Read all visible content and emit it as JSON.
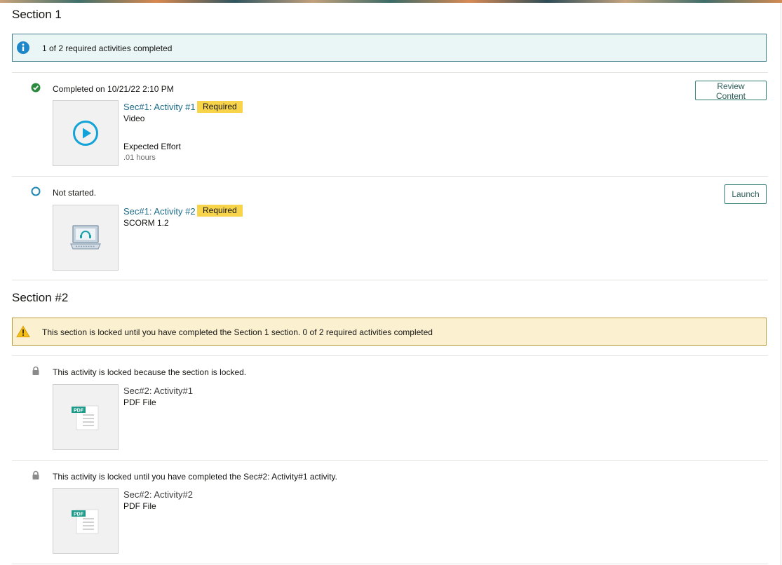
{
  "sections": [
    {
      "title": "Section 1",
      "banner": "1 of 2 required activities completed",
      "activities": [
        {
          "status": "Completed on 10/21/22 2:10 PM",
          "title": "Sec#1: Activity #1",
          "badge": "Required",
          "type": "Video",
          "effort_label": "Expected Effort",
          "effort_value": ".01 hours",
          "action": "Review Content"
        },
        {
          "status": "Not started.",
          "title": "Sec#1: Activity #2",
          "badge": "Required",
          "type": "SCORM 1.2",
          "action": "Launch"
        }
      ]
    },
    {
      "title": "Section #2",
      "banner": "This section is locked until you have completed the Section 1 section. 0 of 2 required activities completed",
      "activities": [
        {
          "status": "This activity is locked because the section is locked.",
          "title": "Sec#2: Activity#1",
          "type": "PDF File",
          "thumb_label": "PDF"
        },
        {
          "status": "This activity is locked until you have completed the Sec#2: Activity#1 activity.",
          "title": "Sec#2: Activity#2",
          "type": "PDF File",
          "thumb_label": "PDF"
        }
      ]
    }
  ],
  "colors": {
    "info_banner_bg": "#eaf6f6",
    "warn_banner_bg": "#fbf1d0",
    "required_badge": "#f8d44b",
    "link": "#1d6b8a",
    "completed_green": "#2b8a3e",
    "not_started_blue": "#1f87b5"
  },
  "icons": {
    "info": "info-icon",
    "warning": "warning-icon",
    "completed": "check-circle-icon",
    "not_started": "empty-circle-icon",
    "locked": "lock-icon",
    "video": "play-circle-icon",
    "scorm": "laptop-headset-icon",
    "pdf": "pdf-file-icon"
  }
}
